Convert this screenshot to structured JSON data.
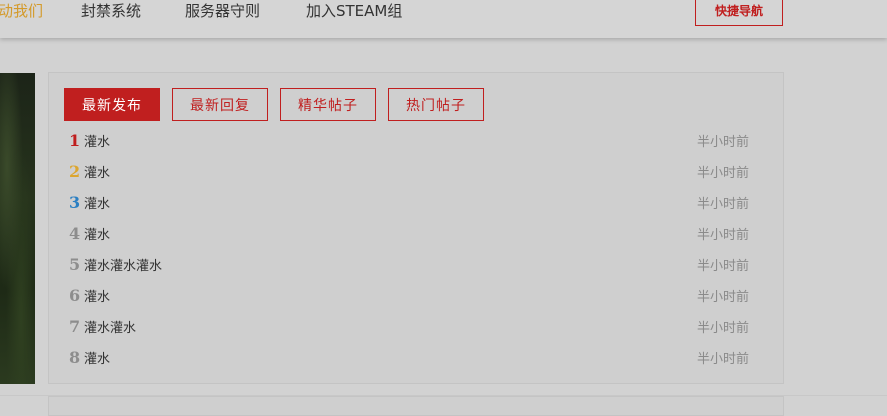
{
  "nav": {
    "items": [
      {
        "label": "动我们",
        "active": true
      },
      {
        "label": "封禁系统",
        "active": false
      },
      {
        "label": "服务器守则",
        "active": false
      },
      {
        "label": "加入STEAM组",
        "active": false
      }
    ],
    "quick_nav_label": "快捷导航"
  },
  "tabs": [
    {
      "label": "最新发布",
      "active": true
    },
    {
      "label": "最新回复",
      "active": false
    },
    {
      "label": "精华帖子",
      "active": false
    },
    {
      "label": "热门帖子",
      "active": false
    }
  ],
  "posts": [
    {
      "rank": "1",
      "title": "灌水",
      "time": "半小时前"
    },
    {
      "rank": "2",
      "title": "灌水",
      "time": "半小时前"
    },
    {
      "rank": "3",
      "title": "灌水",
      "time": "半小时前"
    },
    {
      "rank": "4",
      "title": "灌水",
      "time": "半小时前"
    },
    {
      "rank": "5",
      "title": "灌水灌水灌水",
      "time": "半小时前"
    },
    {
      "rank": "6",
      "title": "灌水",
      "time": "半小时前"
    },
    {
      "rank": "7",
      "title": "灌水灌水",
      "time": "半小时前"
    },
    {
      "rank": "8",
      "title": "灌水",
      "time": "半小时前"
    }
  ],
  "colors": {
    "accent_red": "#c01f1f",
    "rank_1": "#c01f1f",
    "rank_2": "#dca630",
    "rank_3": "#2b7fc2",
    "rank_other": "#8d8d8d",
    "nav_active": "#d49a2a"
  }
}
